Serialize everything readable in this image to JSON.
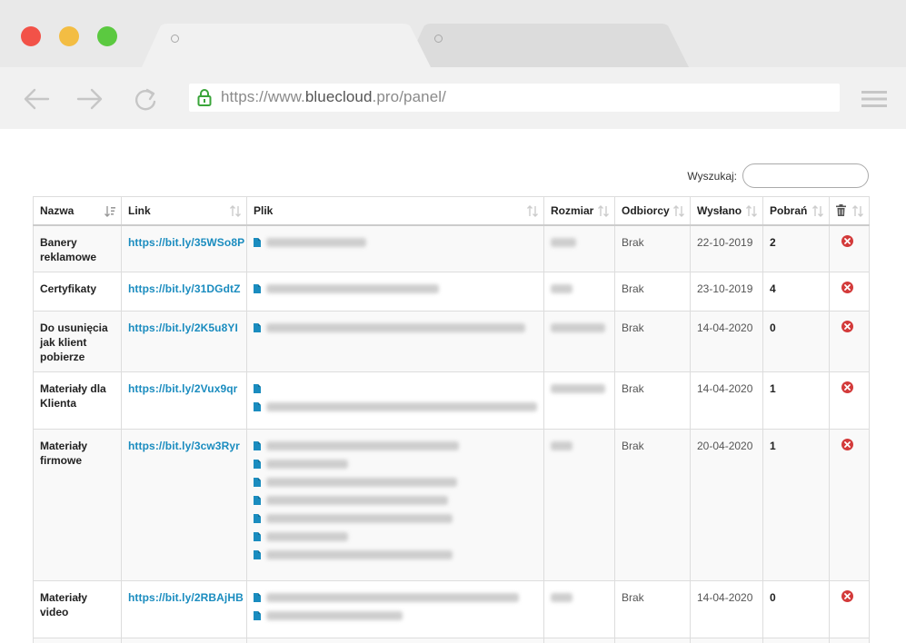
{
  "browser": {
    "url_scheme": "https://www.",
    "url_host": "bluecloud",
    "url_rest": ".pro/panel/"
  },
  "search": {
    "label": "Wyszukaj:",
    "value": ""
  },
  "table": {
    "headers": [
      "Nazwa",
      "Link",
      "Plik",
      "Rozmiar",
      "Odbiorcy",
      "Wysłano",
      "Pobrań"
    ],
    "rows": [
      {
        "name": "Banery reklamowe",
        "link": "https://bit.ly/35WSo8P",
        "recipients": "Brak",
        "sent": "22-10-2019",
        "downloads": "2"
      },
      {
        "name": "Certyfikaty",
        "link": "https://bit.ly/31DGdtZ",
        "recipients": "Brak",
        "sent": "23-10-2019",
        "downloads": "4"
      },
      {
        "name": "Do usunięcia jak klient pobierze",
        "link": "https://bit.ly/2K5u8YI",
        "recipients": "Brak",
        "sent": "14-04-2020",
        "downloads": "0"
      },
      {
        "name": "Materiały dla Klienta",
        "link": "https://bit.ly/2Vux9qr",
        "recipients": "Brak",
        "sent": "14-04-2020",
        "downloads": "1"
      },
      {
        "name": "Materiały firmowe",
        "link": "https://bit.ly/3cw3Ryr",
        "recipients": "Brak",
        "sent": "20-04-2020",
        "downloads": "1"
      },
      {
        "name": "Materiały video",
        "link": "https://bit.ly/2RBAjHB",
        "recipients": "Brak",
        "sent": "14-04-2020",
        "downloads": "0"
      },
      {
        "name": "",
        "link": "",
        "recipients": "",
        "sent": "",
        "downloads": ""
      }
    ]
  },
  "icons": {
    "lock": "lock-icon",
    "file": "file-icon",
    "delete": "delete-icon",
    "trash": "trash-icon",
    "sort": "sort-icon"
  },
  "colors": {
    "link": "#1a8cbf",
    "delete": "#d33a3a",
    "lock": "#3aa53a"
  }
}
